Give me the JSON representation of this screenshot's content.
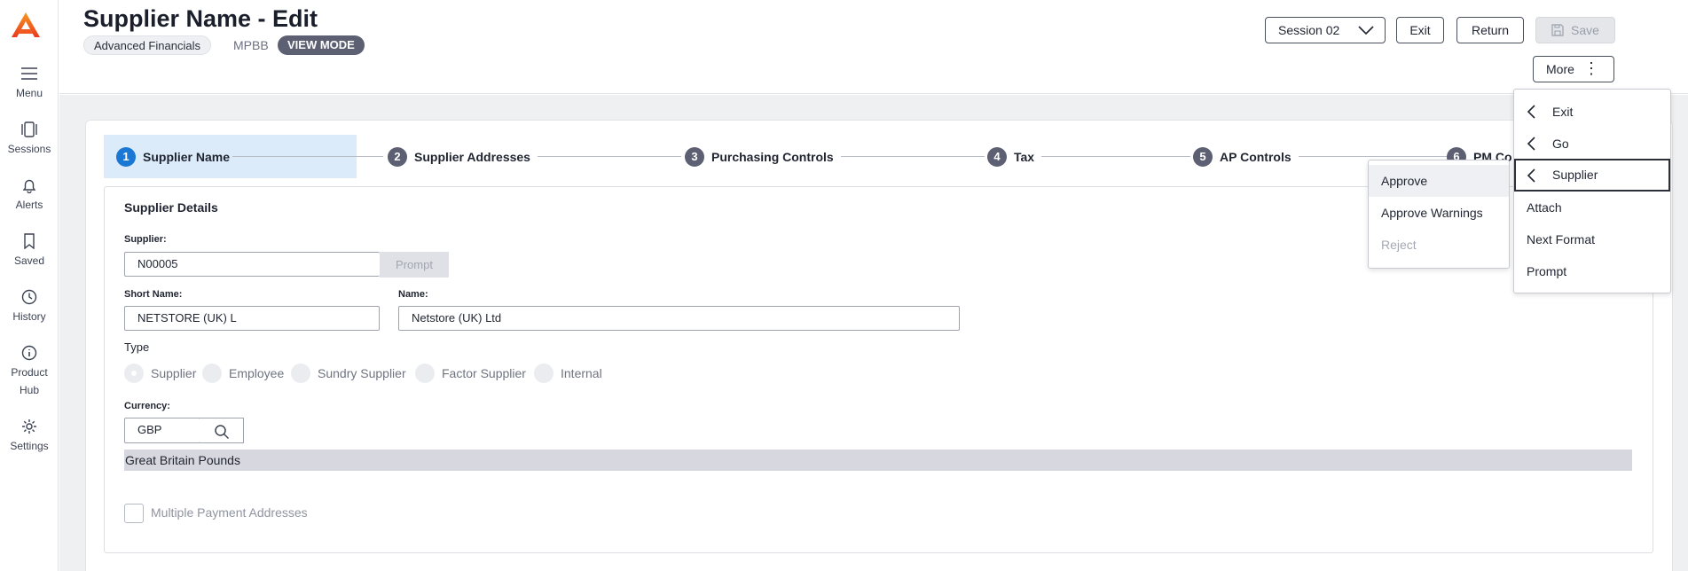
{
  "sidebar": {
    "items": [
      {
        "label": "Menu",
        "icon": "hamburger-icon"
      },
      {
        "label": "Sessions",
        "icon": "sessions-icon"
      },
      {
        "label": "Alerts",
        "icon": "bell-icon"
      },
      {
        "label": "Saved",
        "icon": "bookmark-icon"
      },
      {
        "label": "History",
        "icon": "clock-icon"
      },
      {
        "label_line1": "Product",
        "label_line2": "Hub",
        "icon": "info-icon"
      },
      {
        "label": "Settings",
        "icon": "gear-icon"
      }
    ]
  },
  "header": {
    "title": "Supplier Name - Edit",
    "app_chip": "Advanced Financials",
    "code": "MPBB",
    "mode_chip": "VIEW MODE",
    "session_label": "Session 02",
    "exit_label": "Exit",
    "return_label": "Return",
    "save_label": "Save",
    "more_label": "More"
  },
  "stepper": {
    "steps": [
      {
        "num": "1",
        "label": "Supplier Name"
      },
      {
        "num": "2",
        "label": "Supplier Addresses"
      },
      {
        "num": "3",
        "label": "Purchasing Controls"
      },
      {
        "num": "4",
        "label": "Tax"
      },
      {
        "num": "5",
        "label": "AP Controls"
      },
      {
        "num": "6",
        "label": "PM Co"
      }
    ]
  },
  "form": {
    "section_title": "Supplier Details",
    "supplier_label": "Supplier:",
    "supplier_value": "N00005",
    "prompt_label": "Prompt",
    "short_name_label": "Short Name:",
    "short_name_value": "NETSTORE (UK) L",
    "name_label": "Name:",
    "name_value": "Netstore (UK) Ltd",
    "type_label": "Type",
    "type_options": [
      "Supplier",
      "Employee",
      "Sundry Supplier",
      "Factor Supplier",
      "Internal"
    ],
    "type_selected": "Supplier",
    "currency_label": "Currency:",
    "currency_value": "GBP",
    "currency_desc": "Great Britain Pounds",
    "multiple_payment_label": "Multiple Payment Addresses"
  },
  "more_menu": {
    "items": [
      {
        "label": "Exit",
        "submenu": true
      },
      {
        "label": "Go",
        "submenu": true
      },
      {
        "label": "Supplier",
        "submenu": true
      },
      {
        "label": "Attach",
        "submenu": false
      },
      {
        "label": "Next Format",
        "submenu": false
      },
      {
        "label": "Prompt",
        "submenu": false
      }
    ]
  },
  "approve_menu": {
    "items": [
      {
        "label": "Approve"
      },
      {
        "label": "Approve Warnings"
      },
      {
        "label": "Reject"
      }
    ]
  },
  "colors": {
    "accent": "#1a78d4",
    "logo": "#f05a22",
    "mode_chip": "#5c6072"
  }
}
